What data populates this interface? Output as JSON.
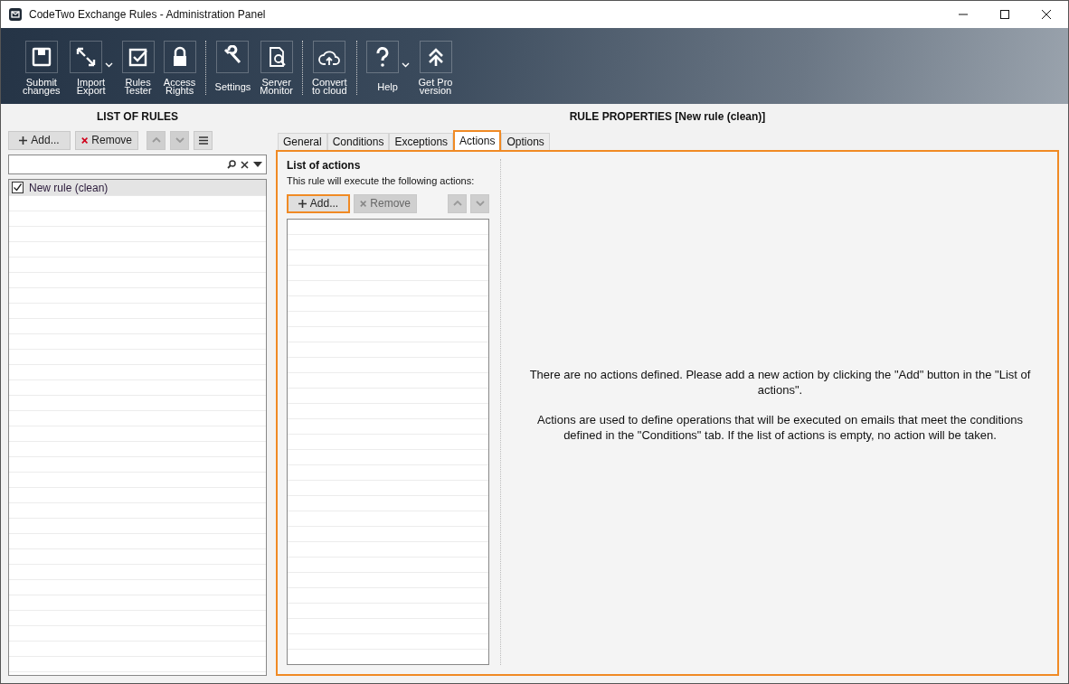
{
  "window": {
    "title": "CodeTwo Exchange Rules - Administration Panel"
  },
  "toolbar": {
    "groups": [
      {
        "items": [
          {
            "kind": "save",
            "label": [
              "Submit",
              "changes"
            ],
            "dropdown": false
          },
          {
            "kind": "import-export",
            "label": [
              "Import",
              "Export"
            ],
            "dropdown": true
          },
          {
            "kind": "check",
            "label": [
              "Rules",
              "Tester"
            ],
            "dropdown": false
          },
          {
            "kind": "lock",
            "label": [
              "Access",
              "Rights"
            ],
            "dropdown": false
          }
        ]
      },
      {
        "items": [
          {
            "kind": "wrench",
            "label": [
              "Settings"
            ],
            "dropdown": false
          },
          {
            "kind": "monitor",
            "label": [
              "Server",
              "Monitor"
            ],
            "dropdown": false
          }
        ]
      },
      {
        "items": [
          {
            "kind": "cloud",
            "label": [
              "Convert",
              "to cloud"
            ],
            "dropdown": false
          }
        ]
      },
      {
        "items": [
          {
            "kind": "question",
            "label": [
              "Help"
            ],
            "dropdown": true
          },
          {
            "kind": "chevrons-up",
            "label": [
              "Get Pro",
              "version"
            ],
            "dropdown": false
          }
        ]
      }
    ]
  },
  "rules_panel": {
    "heading": "LIST OF RULES",
    "buttons": [
      {
        "kind": "add",
        "label": "Add...",
        "disabled": false
      },
      {
        "kind": "remove",
        "label": "Remove",
        "disabled": false
      },
      {
        "kind": "up",
        "disabled": true
      },
      {
        "kind": "down",
        "disabled": true
      },
      {
        "kind": "menu",
        "disabled": false
      }
    ],
    "rules": [
      {
        "name": "New rule (clean)",
        "checked": true,
        "selected": true
      }
    ]
  },
  "properties_panel": {
    "heading": "RULE PROPERTIES [New rule (clean)]",
    "tabs": [
      {
        "label": "General",
        "selected": false,
        "highlighted": false
      },
      {
        "label": "Conditions",
        "selected": false,
        "highlighted": false
      },
      {
        "label": "Exceptions",
        "selected": false,
        "highlighted": false
      },
      {
        "label": "Actions",
        "selected": true,
        "highlighted": true
      },
      {
        "label": "Options",
        "selected": false,
        "highlighted": false
      }
    ],
    "highlighted": true,
    "actions": {
      "title": "List of actions",
      "description": "This rule will execute the following actions:",
      "buttons": [
        {
          "kind": "add",
          "label": "Add...",
          "disabled": false,
          "highlighted": true
        },
        {
          "kind": "remove",
          "label": "Remove",
          "disabled": true,
          "highlighted": false
        },
        {
          "kind": "up",
          "disabled": true,
          "highlighted": false
        },
        {
          "kind": "down",
          "disabled": true,
          "highlighted": false
        }
      ]
    },
    "message": [
      "There are no actions defined. Please add a new action by clicking the \"Add\" button in the \"List of actions\".",
      "Actions are used to define operations that will be executed on emails that meet the conditions defined in the \"Conditions\" tab. If the list of actions is empty, no action will be taken."
    ]
  }
}
